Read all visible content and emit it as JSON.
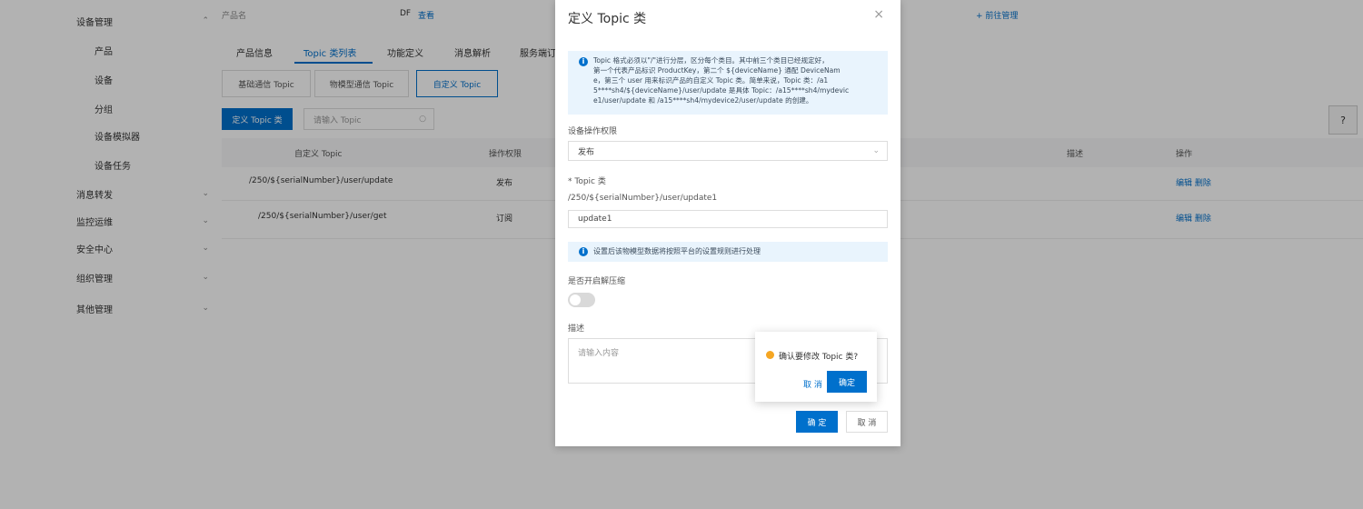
{
  "sidebar": {
    "items": [
      {
        "label": "设备管理",
        "chevron": true,
        "indent": false
      },
      {
        "label": "产品",
        "chevron": false,
        "indent": true
      },
      {
        "label": "设备",
        "chevron": false,
        "indent": true
      },
      {
        "label": "分组",
        "chevron": false,
        "indent": true
      },
      {
        "label": "设备模拟器",
        "chevron": false,
        "indent": true
      },
      {
        "label": "设备任务",
        "chevron": false,
        "indent": true
      },
      {
        "label": "消息转发",
        "chevron": true,
        "indent": false
      },
      {
        "label": "监控运维",
        "chevron": true,
        "indent": false
      },
      {
        "label": "安全中心",
        "chevron": true,
        "indent": false
      },
      {
        "label": "组织管理",
        "chevron": true,
        "indent": false
      },
      {
        "label": "其他管理",
        "chevron": true,
        "indent": false
      }
    ]
  },
  "header": {
    "product_label": "产品名",
    "product_value": "DF",
    "product_link": "查看",
    "right_link": "+ 前往管理"
  },
  "tabs": [
    "产品信息",
    "Topic 类列表",
    "功能定义",
    "消息解析",
    "服务端订阅"
  ],
  "segments": [
    "基础通信 Topic",
    "物模型通信 Topic",
    "自定义 Topic"
  ],
  "toolbar": {
    "define_button": "定义 Topic 类",
    "search_placeholder": "请输入 Topic"
  },
  "table": {
    "headers": [
      "自定义 Topic",
      "操作权限",
      "描述",
      "操作"
    ],
    "rows": [
      {
        "topic": "/250/${serialNumber}/user/update",
        "permission": "发布",
        "actions": "编辑 删除"
      },
      {
        "topic": "/250/${serialNumber}/user/get",
        "permission": "订阅",
        "actions": "编辑 删除"
      }
    ]
  },
  "modal": {
    "title": "定义 Topic 类",
    "close": "×",
    "info_lines": [
      "Topic 格式必须以\"/\"进行分层，区分每个类目。其中前三个类目已经规定好，",
      "第一个代表产品标识 ProductKey，第二个 ${deviceName} 通配 DeviceNam",
      "e，第三个 user 用来标识产品的自定义 Topic 类。简单来说，Topic 类：/a1",
      "5****sh4/${deviceName}/user/update 是具体 Topic：/a15****sh4/mydevic",
      "e1/user/update 和 /a15****sh4/mydevice2/user/update 的创建。"
    ],
    "permission_label": "设备操作权限",
    "permission_value": "发布",
    "topic_label": "* Topic 类",
    "topic_prefix": "/250/${serialNumber}/user/update1",
    "topic_value": "update1",
    "note_text": "设置后该物模型数据将按照平台的设置规则进行处理",
    "compress_label": "是否开启解压缩",
    "desc_label": "描述",
    "desc_placeholder": "请输入内容",
    "ok": "确 定",
    "cancel": "取 消"
  },
  "popconfirm": {
    "text": "确认要修改 Topic 类?",
    "cancel": "取 消",
    "ok": "确定"
  },
  "help": "?"
}
